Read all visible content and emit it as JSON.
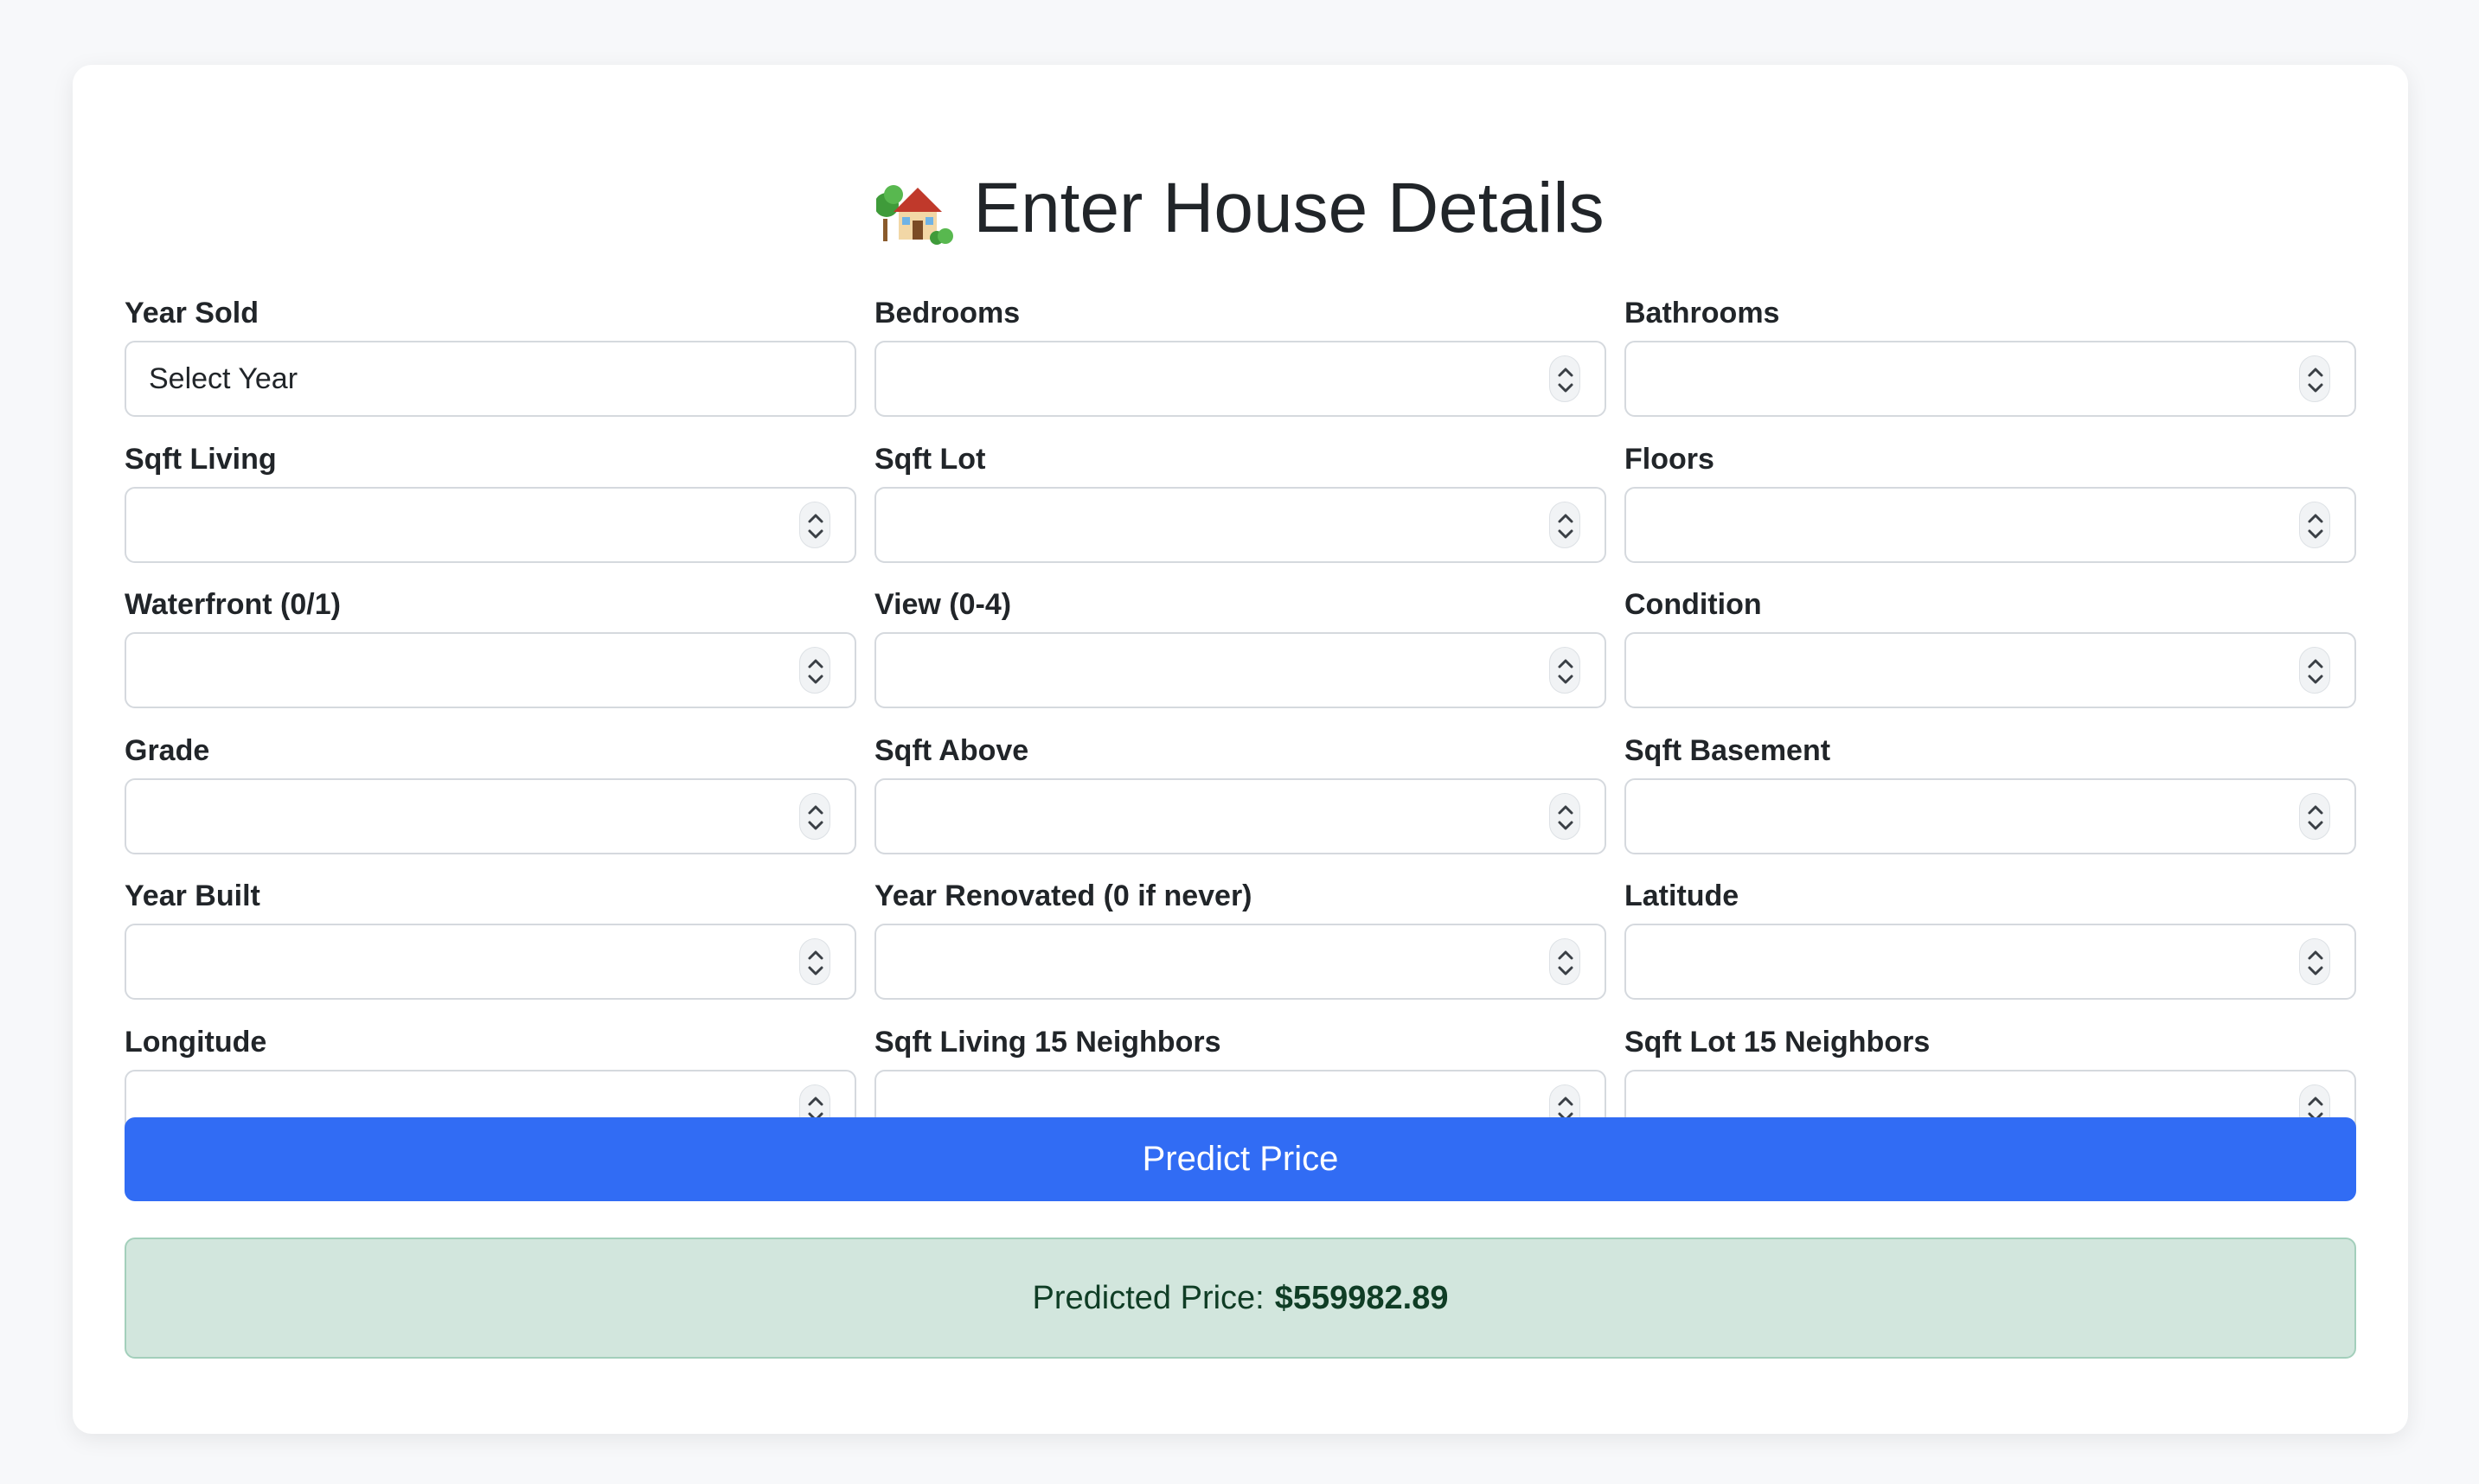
{
  "header": {
    "icon": "house-with-garden-icon",
    "title": "Enter House Details"
  },
  "form": {
    "year_sold": {
      "label": "Year Sold",
      "placeholder": "Select Year"
    },
    "fields": [
      {
        "label": "Bedrooms",
        "value": ""
      },
      {
        "label": "Bathrooms",
        "value": ""
      },
      {
        "label": "Sqft Living",
        "value": ""
      },
      {
        "label": "Sqft Lot",
        "value": ""
      },
      {
        "label": "Floors",
        "value": ""
      },
      {
        "label": "Waterfront (0/1)",
        "value": ""
      },
      {
        "label": "View (0-4)",
        "value": ""
      },
      {
        "label": "Condition",
        "value": ""
      },
      {
        "label": "Grade",
        "value": ""
      },
      {
        "label": "Sqft Above",
        "value": ""
      },
      {
        "label": "Sqft Basement",
        "value": ""
      },
      {
        "label": "Year Built",
        "value": ""
      },
      {
        "label": "Year Renovated (0 if never)",
        "value": ""
      },
      {
        "label": "Latitude",
        "value": ""
      },
      {
        "label": "Longitude",
        "value": ""
      },
      {
        "label": "Sqft Living 15 Neighbors",
        "value": ""
      },
      {
        "label": "Sqft Lot 15 Neighbors",
        "value": ""
      }
    ]
  },
  "actions": {
    "predict_label": "Predict Price"
  },
  "result": {
    "label": "Predicted Price:",
    "value": "$559982.89"
  },
  "colors": {
    "primary_button": "#316cf4",
    "success_bg": "#d2e6dd",
    "success_border": "#a3cfbb",
    "success_text": "#0f3d25"
  }
}
